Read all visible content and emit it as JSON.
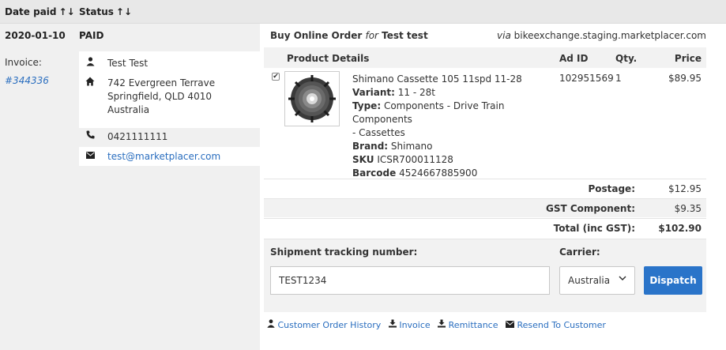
{
  "header": {
    "date_paid": "Date paid",
    "status": "Status",
    "sort_arrows": "↑↓"
  },
  "order": {
    "date": "2020-01-10",
    "status": "PAID",
    "invoice_label": "Invoice:",
    "invoice_number": "#344336"
  },
  "contact": {
    "name": "Test Test",
    "address_line1": "742 Evergreen Terrave",
    "address_line2": "Springfield, QLD 4010",
    "address_line3": "Australia",
    "phone": "0421111111",
    "email": "test@marketplacer.com"
  },
  "order_header": {
    "title_prefix": "Buy Online Order ",
    "title_for": "for",
    "title_name": " Test test",
    "via_label": "via",
    "via_site": "bikeexchange.staging.marketplacer.com"
  },
  "table": {
    "col_product": "Product Details",
    "col_ad_id": "Ad ID",
    "col_qty": "Qty.",
    "col_price": "Price"
  },
  "product": {
    "name": "Shimano Cassette 105 11spd 11-28",
    "variant_label": "Variant:",
    "variant": "11 - 28t",
    "type_label": "Type:",
    "type_line1": "Components - Drive Train Components",
    "type_line2": "- Cassettes",
    "brand_label": "Brand:",
    "brand": "Shimano",
    "sku_label": "SKU",
    "sku": "ICSR700011128",
    "barcode_label": "Barcode",
    "barcode": "4524667885900",
    "ad_id": "102951569",
    "qty": "1",
    "price": "$89.95",
    "checked": "✔"
  },
  "summary": {
    "postage_label": "Postage:",
    "postage": "$12.95",
    "gst_label": "GST Component:",
    "gst": "$9.35",
    "total_label": "Total (inc GST):",
    "total": "$102.90"
  },
  "shipment": {
    "tracking_label": "Shipment tracking number:",
    "tracking_value": "TEST1234",
    "carrier_label": "Carrier:",
    "carrier_value": "Australia",
    "dispatch_label": "Dispatch"
  },
  "links": {
    "customer_history": "Customer Order History",
    "invoice": "Invoice",
    "remittance": "Remittance",
    "resend": "Resend To Customer"
  },
  "colors": {
    "link": "#2a6ebf",
    "button": "#2a74c9",
    "panel_grey": "#f0f0f0"
  }
}
